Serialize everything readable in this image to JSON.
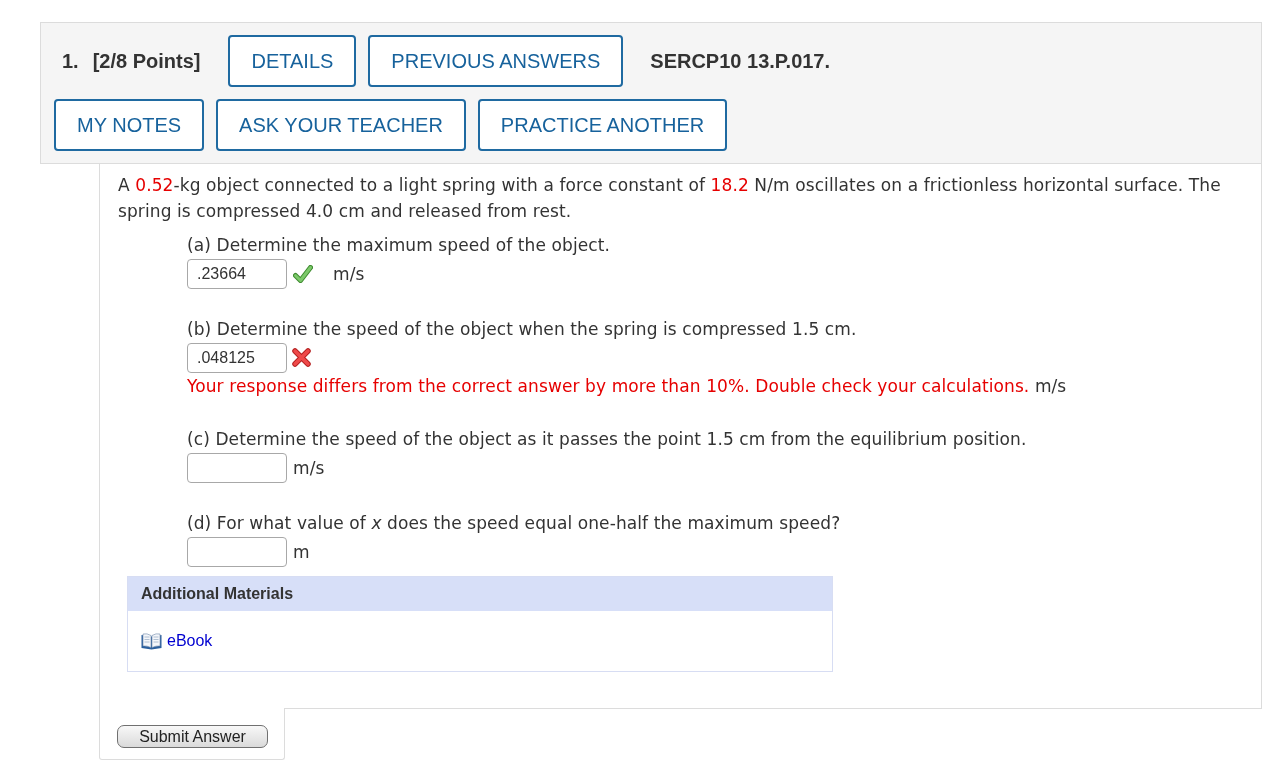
{
  "header": {
    "number": "1.",
    "points": "[2/8 Points]",
    "buttons": [
      "DETAILS",
      "PREVIOUS ANSWERS"
    ],
    "code": "SERCP10 13.P.017.",
    "actions": [
      "MY NOTES",
      "ASK YOUR TEACHER",
      "PRACTICE ANOTHER"
    ]
  },
  "problem": [
    {
      "kind": "plain",
      "text": "A "
    },
    {
      "kind": "value",
      "text": "0.52"
    },
    {
      "kind": "plain",
      "text": "-kg object connected to a light spring with a force constant of "
    },
    {
      "kind": "value",
      "text": "18.2"
    },
    {
      "kind": "plain",
      "text": " N/m oscillates on a frictionless horizontal surface. The spring is compressed 4.0 cm and released from rest."
    }
  ],
  "parts": [
    {
      "label": "(a) Determine the maximum speed of the object.",
      "value": ".23664",
      "correct": true,
      "unit": "m/s"
    },
    {
      "label": "(b) Determine the speed of the object when the spring is compressed 1.5 cm.",
      "value": ".048125",
      "correct": false,
      "feedback": "Your response differs from the correct answer by more than 10%. Double check your calculations.",
      "unit": "m/s"
    },
    {
      "label": "(c) Determine the speed of the object as it passes the point 1.5 cm from the equilibrium position.",
      "unit": "m/s"
    },
    {
      "label": "(d) For what value of *x* does the speed equal one-half the maximum speed?",
      "unit": "m"
    }
  ],
  "additional_materials": {
    "title": "Additional Materials",
    "links": [
      "eBook"
    ]
  },
  "submit": "Submit Answer"
}
